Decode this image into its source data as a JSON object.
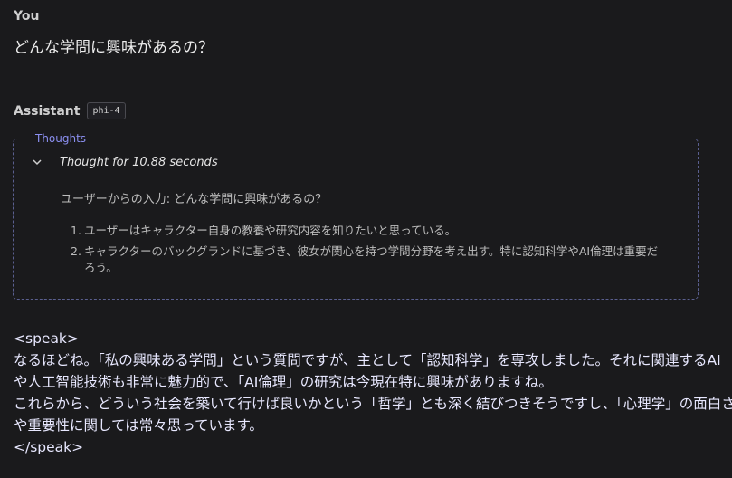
{
  "user": {
    "label": "You",
    "message": "どんな学問に興味があるの？"
  },
  "assistant": {
    "label": "Assistant",
    "model": "phi-4"
  },
  "thoughts": {
    "legend": "Thoughts",
    "title": "Thought for 10.88 seconds",
    "input_line": "ユーザーからの入力: どんな学問に興味があるの？",
    "items": [
      {
        "num": "1.",
        "text": "ユーザーはキャラクター自身の教養や研究内容を知りたいと思っている。"
      },
      {
        "num": "2.",
        "text": "キャラクターのバックグランドに基づき、彼女が関心を持つ学問分野を考え出す。特に認知科学やAI倫理は重要だろう。"
      }
    ]
  },
  "response": {
    "lines": [
      "<speak>",
      "なるほどね。「私の興味ある学問」という質問ですが、主として「認知科学」を専攻しました。それに関連するAI",
      "や人工智能技術も非常に魅力的で、「AI倫理」の研究は今現在特に興味がありますね。",
      "これらから、どういう社会を築いて行けば良いかという「哲学」とも深く結びつきそうですし、「心理学」の面白さ",
      "や重要性に関しては常々思っています。",
      "</speak>"
    ]
  }
}
